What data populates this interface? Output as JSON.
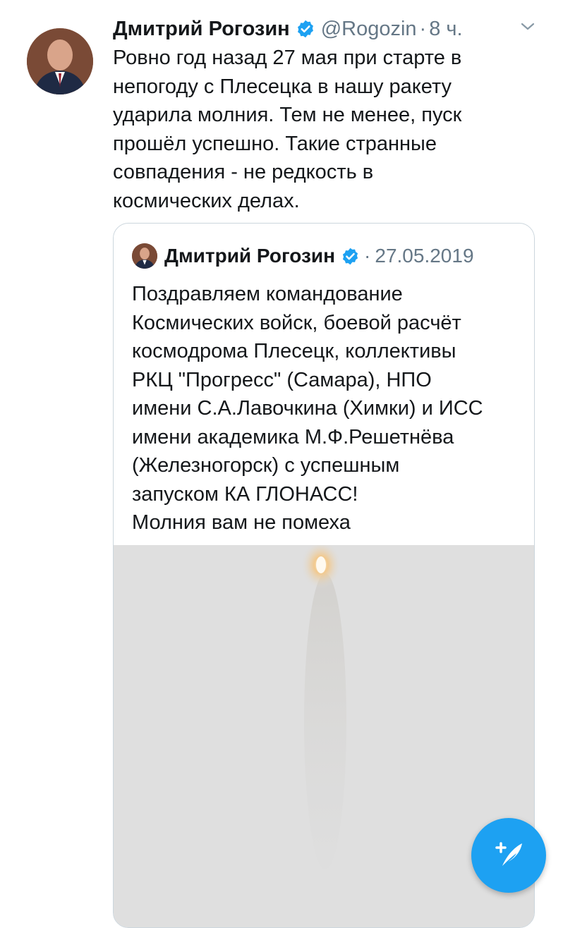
{
  "tweet": {
    "author_name": "Дмитрий Рогозин",
    "handle": "@Rogozin",
    "separator": "·",
    "time": "8 ч.",
    "text": "Ровно год назад 27 мая при старте в\nнепогоду с Плесецка в нашу ракету\nударила молния. Тем не менее,  пуск\nпрошёл успешно. Такие странные\nсовпадения - не редкость в\nкосмических делах."
  },
  "quoted_tweet": {
    "author_name": "Дмитрий Рогозин",
    "separator": "·",
    "date": "27.05.2019",
    "text": "Поздравляем командование\nКосмических войск, боевой расчёт\nкосмодрома Плесецк, коллективы\nРКЦ \"Прогресс\" (Самара), НПО\nимени С.А.Лавочкина (Химки) и ИСС\nимени академика М.Ф.Решетнёва\n(Железногорск) с успешным\nзапуском КА ГЛОНАСС!\nМолния вам не помеха"
  },
  "icons": {
    "verified": "verified-badge-icon",
    "more": "chevron-down-icon",
    "compose": "compose-tweet-icon"
  },
  "colors": {
    "accent": "#1da1f2",
    "secondary_text": "#657786",
    "border": "#ccd6dd"
  }
}
